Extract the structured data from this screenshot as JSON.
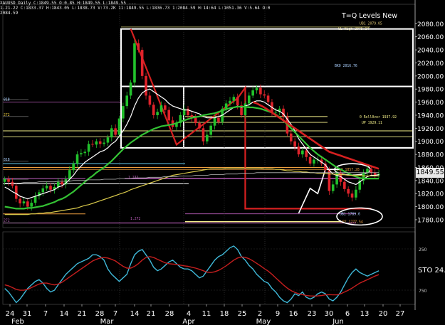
{
  "window": {
    "header_line1": "XAUUSD Daily C:1849.55 O:0.85 H:1849.55 L:1849.55 ...",
    "header_line2": "1-21-22 C:1833.37 H:1843.05 L:1838.73 V:73.2K 11:1849.55 L:1836.73 1:2084.59 H:14:64 L:1051.36 V:5.64 O:0",
    "header_line3": "2084.59",
    "title": "T=Q Levels New",
    "last_price": "1849.55",
    "sto_label": "STO  24."
  },
  "colors": {
    "background": "#000000",
    "bull_candle": "#22c22c",
    "bear_candle": "#e0232b",
    "ma_white": "#ffffff",
    "ma_green": "#34c234",
    "ma_yellow": "#d8c84a",
    "ma_red": "#d62020",
    "osc_blue": "#3fb8d8",
    "osc_red": "#c41e1e",
    "box_white": "#ffffff",
    "level_yellow": "#f4f08a",
    "level_orange": "#f0a040",
    "level_magenta": "#c060c0",
    "level_cyan": "#66ccee"
  },
  "chart_data": [
    {
      "type": "line",
      "title": "T=Q Levels New",
      "symbol": "XAUUSD",
      "timeframe": "Daily",
      "ylim": [
        1768,
        2088
      ],
      "y_ticks": [
        1780,
        1800,
        1820,
        1840,
        1860,
        1880,
        1900,
        1920,
        1940,
        1960,
        1980,
        2000,
        2020,
        2040,
        2060,
        2080
      ],
      "x_tick_labels": [
        "24",
        "31",
        "7",
        "14",
        "21",
        "28",
        "7",
        "14",
        "21",
        "28",
        "4",
        "11",
        "18",
        "25",
        "2",
        "9",
        "16",
        "23",
        "30",
        "6",
        "13",
        "20",
        "27"
      ],
      "month_labels": [
        "Feb",
        "Mar",
        "Apr",
        "May",
        "Jun"
      ],
      "close_series": [
        1842,
        1838,
        1832,
        1812,
        1805,
        1808,
        1800,
        1806,
        1816,
        1822,
        1828,
        1832,
        1826,
        1830,
        1838,
        1834,
        1842,
        1856,
        1866,
        1880,
        1882,
        1884,
        1896,
        1895,
        1900,
        1896,
        1898,
        1906,
        1920,
        1910,
        1935,
        1954,
        1970,
        1990,
        2050,
        2040,
        2000,
        1970,
        1956,
        1940,
        1945,
        1955,
        1948,
        1932,
        1922,
        1928,
        1940,
        1950,
        1940,
        1936,
        1928,
        1920,
        1900,
        1910,
        1924,
        1936,
        1930,
        1950,
        1958,
        1962,
        1968,
        1955,
        1940,
        1958,
        1970,
        1978,
        1982,
        1972,
        1970,
        1960,
        1945,
        1945,
        1950,
        1938,
        1912,
        1900,
        1892,
        1880,
        1886,
        1876,
        1866,
        1872,
        1872,
        1866,
        1856,
        1824,
        1834,
        1852,
        1838,
        1827,
        1820,
        1814,
        1826,
        1840,
        1852,
        1858,
        1852,
        1848,
        1850
      ],
      "series": [
        {
          "name": "MA short",
          "values": [
            1830,
            1827,
            1823,
            1820,
            1816,
            1814,
            1812,
            1814,
            1816,
            1818,
            1820,
            1822,
            1824,
            1826,
            1830,
            1832,
            1836,
            1842,
            1848,
            1856,
            1862,
            1868,
            1872,
            1876,
            1880,
            1884,
            1886,
            1890,
            1896,
            1900,
            1908,
            1916,
            1926,
            1938,
            1954,
            1966,
            1974,
            1978,
            1980,
            1976,
            1972,
            1968,
            1964,
            1958,
            1954,
            1952,
            1950,
            1948,
            1948,
            1946,
            1944,
            1942,
            1938,
            1936,
            1936,
            1936,
            1938,
            1940,
            1944,
            1948,
            1952,
            1954,
            1952,
            1954,
            1956,
            1960,
            1962,
            1962,
            1960,
            1956,
            1952,
            1948,
            1946,
            1942,
            1934,
            1926,
            1916,
            1904,
            1896,
            1888,
            1880,
            1876,
            1872,
            1868,
            1864,
            1856,
            1850,
            1848,
            1846,
            1842,
            1838,
            1836,
            1834,
            1838,
            1842,
            1846,
            1848,
            1848,
            1849
          ]
        },
        {
          "name": "MA medium",
          "values": [
            1800,
            1799,
            1798,
            1797,
            1797,
            1797,
            1798,
            1798,
            1799,
            1800,
            1801,
            1803,
            1805,
            1807,
            1810,
            1812,
            1815,
            1819,
            1823,
            1828,
            1833,
            1838,
            1843,
            1847,
            1852,
            1856,
            1860,
            1865,
            1870,
            1876,
            1882,
            1888,
            1893,
            1898,
            1902,
            1906,
            1910,
            1913,
            1916,
            1919,
            1921,
            1923,
            1924,
            1925,
            1926,
            1928,
            1930,
            1932,
            1934,
            1936,
            1937,
            1938,
            1940,
            1941,
            1942,
            1943,
            1945,
            1947,
            1949,
            1951,
            1952,
            1953,
            1953,
            1953,
            1952,
            1952,
            1951,
            1950,
            1948,
            1946,
            1944,
            1941,
            1937,
            1932,
            1926,
            1920,
            1914,
            1908,
            1902,
            1896,
            1890,
            1885,
            1880,
            1876,
            1872,
            1868,
            1864,
            1860,
            1857,
            1854,
            1851,
            1848,
            1846,
            1844,
            1843,
            1843,
            1843,
            1843,
            1843
          ]
        },
        {
          "name": "MA long",
          "values": [
            1788,
            1788,
            1788,
            1788,
            1788,
            1788,
            1788,
            1789,
            1789,
            1790,
            1790,
            1791,
            1791,
            1792,
            1793,
            1794,
            1795,
            1796,
            1797,
            1798,
            1800,
            1802,
            1803,
            1805,
            1807,
            1809,
            1811,
            1813,
            1815,
            1817,
            1819,
            1821,
            1823,
            1826,
            1828,
            1830,
            1832,
            1834,
            1836,
            1838,
            1840,
            1842,
            1844,
            1846,
            1848,
            1849,
            1850,
            1851,
            1852,
            1853,
            1854,
            1855,
            1856,
            1857,
            1858,
            1858,
            1858,
            1858,
            1859,
            1859,
            1859,
            1859,
            1859,
            1859,
            1859,
            1859,
            1859,
            1859,
            1858,
            1858,
            1858,
            1857,
            1857,
            1856,
            1855,
            1855,
            1854,
            1854,
            1853,
            1853,
            1852,
            1852,
            1851,
            1851,
            1851,
            1850,
            1850,
            1849,
            1849,
            1849,
            1848,
            1848,
            1848,
            1848,
            1847,
            1847,
            1847,
            1847,
            1847
          ]
        },
        {
          "name": "MA very long",
          "values": [
            1836,
            1836,
            1836,
            1836,
            1836,
            1837,
            1837,
            1837,
            1837,
            1838,
            1838,
            1838,
            1838,
            1838,
            1839,
            1839,
            1839,
            1839,
            1840,
            1840,
            1840,
            1840,
            1841,
            1841,
            1841,
            1841,
            1842,
            1842,
            1842,
            1842,
            1843,
            1843,
            1843,
            1843,
            1844,
            1844,
            1844,
            1844,
            1845,
            1845,
            1845,
            1845,
            1846,
            1846,
            1846,
            1846,
            1847,
            1847,
            1847,
            1847,
            1848,
            1848,
            1848,
            1848,
            1849,
            1849,
            1849,
            1849,
            1850,
            1850,
            1850,
            1850,
            1851,
            1851,
            1851,
            1851,
            1852,
            1852,
            1852,
            1852,
            1852,
            1852,
            1852,
            1852,
            1852,
            1852,
            1852,
            1852,
            1852,
            1852,
            1852,
            1852,
            1852,
            1852,
            1852,
            1852,
            1852,
            1852,
            1852,
            1852,
            1852,
            1852,
            1852,
            1852,
            1852,
            1852,
            1852,
            1852,
            1852
          ]
        },
        {
          "name": "Downtrend MA",
          "values": [
            null,
            null,
            null,
            null,
            null,
            null,
            null,
            null,
            null,
            null,
            null,
            null,
            null,
            null,
            null,
            null,
            null,
            null,
            null,
            null,
            null,
            null,
            null,
            null,
            null,
            null,
            null,
            null,
            null,
            null,
            null,
            null,
            null,
            null,
            null,
            null,
            null,
            null,
            null,
            null,
            null,
            null,
            null,
            null,
            null,
            null,
            null,
            null,
            null,
            null,
            null,
            null,
            null,
            null,
            null,
            null,
            null,
            null,
            null,
            null,
            null,
            null,
            null,
            null,
            null,
            1960,
            1958,
            1955,
            1952,
            1948,
            1944,
            1940,
            1936,
            1932,
            1928,
            1924,
            1920,
            1916,
            1912,
            1908,
            1904,
            1900,
            1896,
            1892,
            1888,
            1884,
            1882,
            1880,
            1878,
            1876,
            1874,
            1872,
            1870,
            1868,
            1866,
            1864,
            1862,
            1860,
            1858
          ]
        }
      ],
      "levels": [
        {
          "label": "UL High 2075.14",
          "value": 2075
        },
        {
          "label": "UB1 2079.05",
          "value": 2079
        },
        {
          "label": "BKO 2016.76",
          "value": 2017
        },
        {
          "label": "0 Roll0ver 1937.92",
          "value": 1938
        },
        {
          "label": "UP 1929.11",
          "value": 1929
        },
        {
          "label": "UL3 1857.28",
          "value": 1857
        },
        {
          "label": "UB1 1789.6",
          "value": 1789
        },
        {
          "label": "LP2 1777.54",
          "value": 1777
        },
        {
          "label": "1.272",
          "value": 1842
        },
        {
          "label": "1.272",
          "value": 1778
        },
        {
          "label": "272",
          "value": 1938
        },
        {
          "label": "272",
          "value": 1775
        },
        {
          "label": "818",
          "value": 1960
        },
        {
          "label": "818",
          "value": 1868
        }
      ]
    },
    {
      "type": "line",
      "title": "STO",
      "ylim": [
        -50,
        360
      ],
      "y_ticks": [
        250,
        750
      ],
      "series": [
        {
          "name": "STO fast",
          "values": [
            40,
            20,
            -10,
            -40,
            -20,
            10,
            40,
            60,
            80,
            90,
            70,
            40,
            20,
            30,
            60,
            90,
            120,
            140,
            160,
            180,
            190,
            200,
            210,
            230,
            230,
            220,
            200,
            150,
            120,
            100,
            80,
            100,
            120,
            180,
            230,
            250,
            260,
            230,
            200,
            160,
            140,
            150,
            170,
            190,
            200,
            180,
            160,
            150,
            150,
            140,
            120,
            100,
            110,
            140,
            170,
            200,
            220,
            230,
            250,
            270,
            280,
            260,
            220,
            200,
            170,
            150,
            120,
            100,
            80,
            70,
            40,
            20,
            -10,
            -30,
            -40,
            -20,
            10,
            0,
            20,
            -10,
            -20,
            -10,
            10,
            20,
            10,
            -20,
            -30,
            -10,
            20,
            60,
            100,
            130,
            150,
            130,
            120,
            110,
            120,
            130,
            140
          ]
        },
        {
          "name": "STO slow",
          "values": [
            60,
            55,
            45,
            35,
            30,
            30,
            35,
            45,
            55,
            65,
            70,
            70,
            65,
            60,
            65,
            75,
            90,
            105,
            120,
            135,
            150,
            165,
            180,
            195,
            205,
            212,
            215,
            212,
            205,
            195,
            180,
            165,
            155,
            155,
            165,
            180,
            200,
            215,
            220,
            215,
            205,
            195,
            185,
            180,
            178,
            176,
            172,
            168,
            165,
            160,
            155,
            148,
            140,
            132,
            130,
            134,
            142,
            154,
            168,
            184,
            200,
            212,
            218,
            216,
            208,
            196,
            182,
            168,
            152,
            138,
            120,
            100,
            80,
            60,
            42,
            28,
            18,
            10,
            5,
            0,
            -2,
            -3,
            -2,
            0,
            4,
            5,
            4,
            4,
            10,
            20,
            30,
            42,
            56,
            70,
            80,
            90,
            100,
            110,
            118
          ]
        }
      ]
    }
  ]
}
